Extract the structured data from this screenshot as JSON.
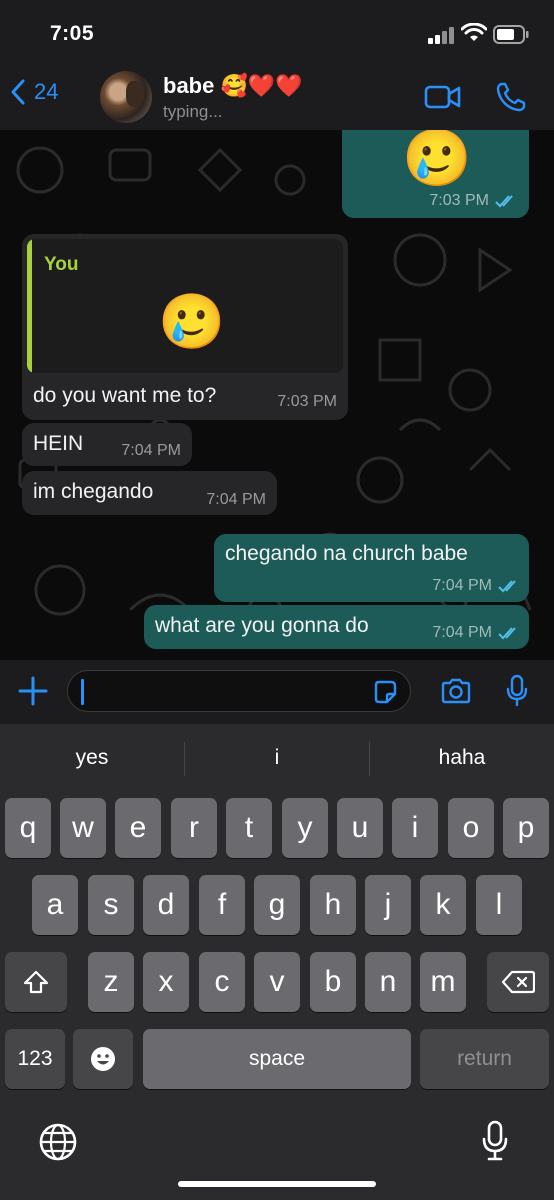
{
  "status_bar": {
    "time": "7:05"
  },
  "header": {
    "back_count": "24",
    "contact_name": "babe 🥰❤️❤️",
    "contact_status": "typing..."
  },
  "messages": [
    {
      "type": "outgoing",
      "emoji": "🥲",
      "time": "7:03 PM",
      "read": true
    },
    {
      "type": "incoming",
      "reply_author": "You",
      "reply_emoji": "🥲",
      "text": "do you want me to?",
      "time": "7:03 PM"
    },
    {
      "type": "incoming",
      "text": "HEIN",
      "time": "7:04 PM"
    },
    {
      "type": "incoming",
      "text": "im chegando",
      "time": "7:04 PM"
    },
    {
      "type": "outgoing",
      "text": "chegando na church babe",
      "time": "7:04 PM",
      "read": true
    },
    {
      "type": "outgoing",
      "text": "what are you gonna do",
      "time": "7:04 PM",
      "read": true
    }
  ],
  "input": {
    "value": "",
    "placeholder": ""
  },
  "keyboard": {
    "suggestions": [
      "yes",
      "i",
      "haha"
    ],
    "row1": [
      "q",
      "w",
      "e",
      "r",
      "t",
      "y",
      "u",
      "i",
      "o",
      "p"
    ],
    "row2": [
      "a",
      "s",
      "d",
      "f",
      "g",
      "h",
      "j",
      "k",
      "l"
    ],
    "row3": [
      "z",
      "x",
      "c",
      "v",
      "b",
      "n",
      "m"
    ],
    "numbers_label": "123",
    "space_label": "space",
    "return_label": "return"
  },
  "colors": {
    "accent": "#2a8ff7",
    "outgoing_bubble": "#1c5b57",
    "incoming_bubble": "#262628",
    "quote_bar": "#a6d23c"
  },
  "icons": {
    "back": "chevron-left-icon",
    "video": "video-camera-icon",
    "call": "phone-icon",
    "attach": "plus-icon",
    "sticker": "sticker-icon",
    "camera": "camera-icon",
    "mic": "microphone-icon",
    "shift": "shift-icon",
    "delete": "backspace-icon",
    "emoji": "emoji-icon",
    "globe": "globe-icon",
    "dictation": "dictation-mic-icon"
  }
}
